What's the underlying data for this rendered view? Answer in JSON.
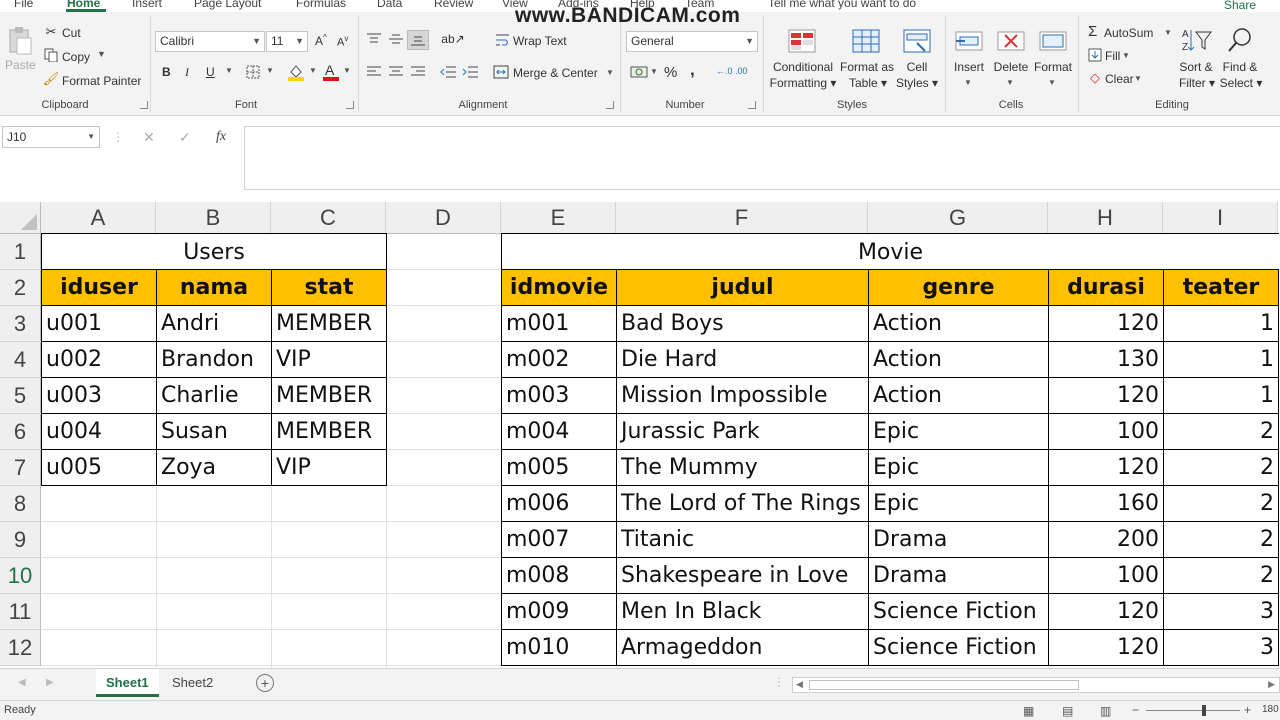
{
  "menu": {
    "tabs": [
      "File",
      "Home",
      "Insert",
      "Page Layout",
      "Formulas",
      "Data",
      "Review",
      "View",
      "Add-ins",
      "Help",
      "Team"
    ],
    "tell_me": "Tell me what you want to do",
    "share": "Share",
    "watermark": "www.BANDICAM.com"
  },
  "clipboard": {
    "paste": "Paste",
    "cut": "Cut",
    "copy": "Copy",
    "format_painter": "Format Painter",
    "label": "Clipboard"
  },
  "font": {
    "name": "Calibri",
    "size": "11",
    "bold": "B",
    "italic": "I",
    "underline": "U",
    "label": "Font"
  },
  "alignment": {
    "wrap_text": "Wrap Text",
    "merge_center": "Merge & Center",
    "label": "Alignment"
  },
  "number": {
    "format": "General",
    "percent": "%",
    "comma": ",",
    "label": "Number"
  },
  "styles": {
    "conditional": [
      "Conditional",
      "Formatting"
    ],
    "format_table": [
      "Format as",
      "Table"
    ],
    "cell_styles": [
      "Cell",
      "Styles"
    ],
    "label": "Styles"
  },
  "cells": {
    "insert": "Insert",
    "delete": "Delete",
    "format": "Format",
    "label": "Cells"
  },
  "editing": {
    "autosum": "AutoSum",
    "fill": "Fill",
    "clear": "Clear",
    "sort": [
      "Sort &",
      "Filter"
    ],
    "find": [
      "Find &",
      "Select"
    ],
    "label": "Editing"
  },
  "formula_bar": {
    "name_box": "J10",
    "cancel": "✕",
    "enter": "✓",
    "fx": "fx",
    "content": ""
  },
  "columns": [
    "A",
    "B",
    "C",
    "D",
    "E",
    "F",
    "G",
    "H",
    "I"
  ],
  "rows": [
    "1",
    "2",
    "3",
    "4",
    "5",
    "6",
    "7",
    "8",
    "9",
    "10",
    "11",
    "12"
  ],
  "users_table": {
    "title": "Users",
    "headers": [
      "iduser",
      "nama",
      "stat"
    ],
    "rows": [
      [
        "u001",
        "Andri",
        "MEMBER"
      ],
      [
        "u002",
        "Brandon",
        "VIP"
      ],
      [
        "u003",
        "Charlie",
        "MEMBER"
      ],
      [
        "u004",
        "Susan",
        "MEMBER"
      ],
      [
        "u005",
        "Zoya",
        "VIP"
      ]
    ]
  },
  "movie_table": {
    "title": "Movie",
    "headers": [
      "idmovie",
      "judul",
      "genre",
      "durasi",
      "teater"
    ],
    "rows": [
      [
        "m001",
        "Bad Boys",
        "Action",
        "120",
        "1"
      ],
      [
        "m002",
        "Die Hard",
        "Action",
        "130",
        "1"
      ],
      [
        "m003",
        "Mission Impossible",
        "Action",
        "120",
        "1"
      ],
      [
        "m004",
        "Jurassic Park",
        "Epic",
        "100",
        "2"
      ],
      [
        "m005",
        "The Mummy",
        "Epic",
        "120",
        "2"
      ],
      [
        "m006",
        "The Lord of The Rings",
        "Epic",
        "160",
        "2"
      ],
      [
        "m007",
        "Titanic",
        "Drama",
        "200",
        "2"
      ],
      [
        "m008",
        "Shakespeare in Love",
        "Drama",
        "100",
        "2"
      ],
      [
        "m009",
        "Men In Black",
        "Science Fiction",
        "120",
        "3"
      ],
      [
        "m010",
        "Armageddon",
        "Science Fiction",
        "120",
        "3"
      ]
    ]
  },
  "sheets": [
    "Sheet1",
    "Sheet2"
  ],
  "active_sheet": "Sheet1",
  "status": {
    "ready": "Ready",
    "zoom": "180"
  },
  "colors": {
    "accent": "#217346",
    "header_fill": "#ffc000"
  }
}
